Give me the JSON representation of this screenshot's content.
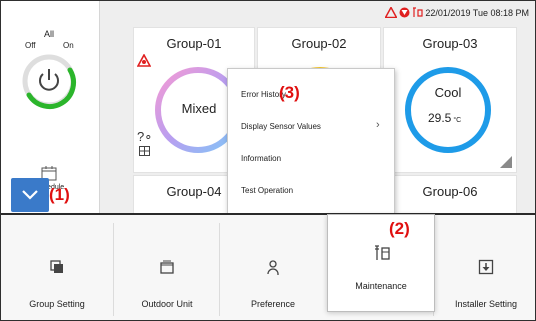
{
  "status": {
    "datetime": "22/01/2019 Tue 08:18 PM",
    "icons": [
      "warning-icon",
      "filter-icon",
      "maintenance-icon"
    ]
  },
  "power": {
    "label": "All",
    "off": "Off",
    "on": "On"
  },
  "schedule": {
    "label": "Schedule"
  },
  "groups": [
    {
      "name": "Group-01",
      "mode": "Mixed",
      "temp": ""
    },
    {
      "name": "Group-02",
      "mode": "",
      "temp": ""
    },
    {
      "name": "Group-03",
      "mode": "Cool",
      "temp": "29.5",
      "unit": "°C"
    },
    {
      "name": "Group-04",
      "mode": "",
      "temp": ""
    },
    {
      "name": "Group-06",
      "mode": "",
      "temp": ""
    }
  ],
  "menu": {
    "items": [
      "Error History",
      "Display Sensor Values",
      "Information",
      "Test Operation"
    ]
  },
  "bottom": {
    "tiles": [
      "Group Setting",
      "Outdoor Unit",
      "Preference",
      "Maintenance",
      "Installer Setting"
    ]
  },
  "annotations": [
    "(1)",
    "(2)",
    "(3)"
  ],
  "colors": {
    "accent": "#3a7ac9",
    "power_green": "#2bb52b",
    "cool_ring": "#1e9be8",
    "warning": "#e02020",
    "annotation": "#e01010"
  }
}
